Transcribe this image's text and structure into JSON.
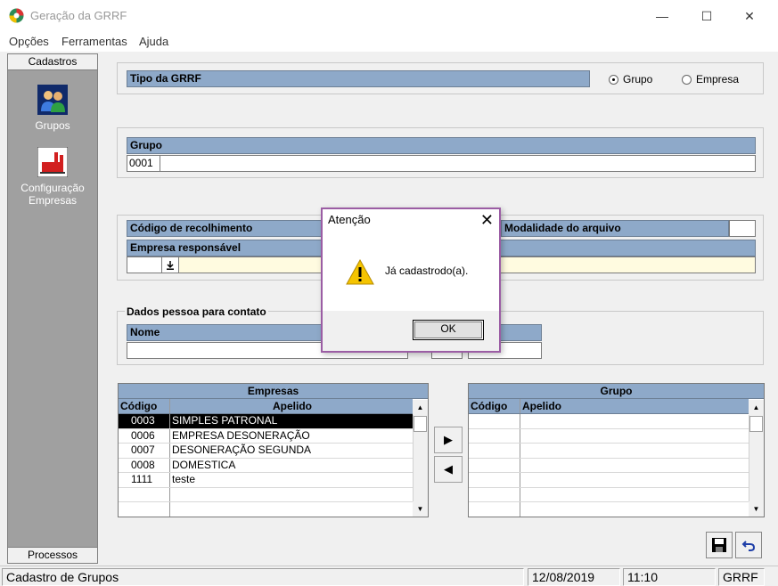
{
  "window": {
    "title": "Geração da GRRF",
    "minimize": "—",
    "maximize": "☐",
    "close": "✕"
  },
  "menu": [
    "Opções",
    "Ferramentas",
    "Ajuda"
  ],
  "sidebar": {
    "header": "Cadastros",
    "footer": "Processos",
    "items": [
      {
        "label": "Grupos"
      },
      {
        "label": "Configuração Empresas"
      }
    ]
  },
  "tipo": {
    "label": "Tipo da GRRF",
    "options": [
      "Grupo",
      "Empresa"
    ],
    "selected": "Grupo"
  },
  "grupo": {
    "label": "Grupo",
    "code": "0001",
    "name": ""
  },
  "recolhimento": {
    "codigo_label": "Código de recolhimento",
    "modalidade_label": "Modalidade do arquivo",
    "empresa_label": "Empresa responsável"
  },
  "contato": {
    "legend": "Dados pessoa para contato",
    "nome_label": "Nome"
  },
  "empresas_grid": {
    "title": "Empresas",
    "col_code": "Código",
    "col_name": "Apelido",
    "rows": [
      {
        "code": "0003",
        "name": "SIMPLES PATRONAL"
      },
      {
        "code": "0006",
        "name": "EMPRESA DESONERAÇÃO"
      },
      {
        "code": "0007",
        "name": "DESONERAÇÃO SEGUNDA"
      },
      {
        "code": "0008",
        "name": "DOMESTICA"
      },
      {
        "code": "1111",
        "name": "teste"
      }
    ],
    "selected_index": 0
  },
  "grupo_grid": {
    "title": "Grupo",
    "col_code": "Código",
    "col_name": "Apelido"
  },
  "transfer": {
    "add_icon": "arrow-right-icon",
    "remove_icon": "arrow-left-icon",
    "add_glyph": "▶",
    "remove_glyph": "◀"
  },
  "dialog": {
    "title": "Atenção",
    "message": "Já cadastrodo(a).",
    "ok": "OK",
    "close": "✕"
  },
  "statusbar": {
    "screen": "Cadastro de Grupos",
    "date": "12/08/2019",
    "time": "11:10",
    "module": "GRRF"
  },
  "colors": {
    "header_blue": "#8ea9c9",
    "dialog_border": "#9b5da4",
    "yellow_field": "#fffbe0"
  }
}
